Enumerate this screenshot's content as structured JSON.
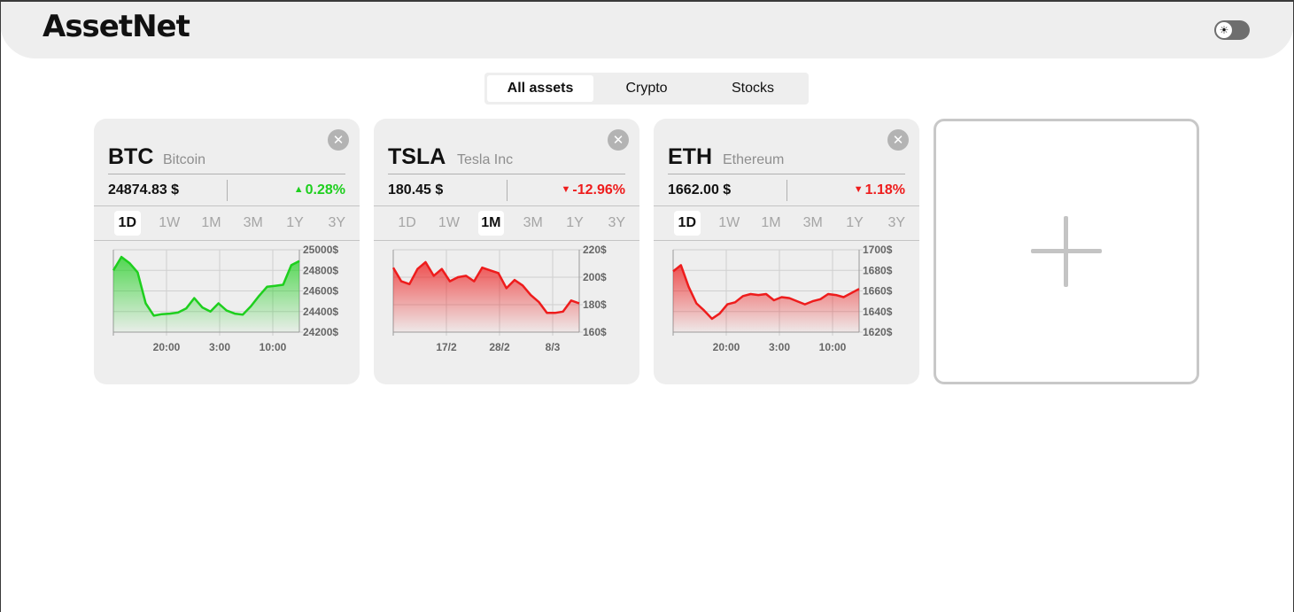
{
  "app": {
    "logo": "AssetNet"
  },
  "theme_toggle": {
    "icon": "sun-icon",
    "glyph": "☀"
  },
  "filter_tabs": [
    {
      "label": "All assets",
      "active": true
    },
    {
      "label": "Crypto",
      "active": false
    },
    {
      "label": "Stocks",
      "active": false
    }
  ],
  "close_glyph": "✕",
  "cards": [
    {
      "symbol": "BTC",
      "name": "Bitcoin",
      "price": "24874.83 $",
      "change": "0.28%",
      "direction": "up",
      "color": "#1ecf1e",
      "ranges": [
        "1D",
        "1W",
        "1M",
        "3M",
        "1Y",
        "3Y"
      ],
      "active_range": "1D",
      "chart_data": {
        "type": "area",
        "y_ticks": [
          "25000$",
          "24800$",
          "24600$",
          "24400$",
          "24200$"
        ],
        "y_range": [
          24200,
          25000
        ],
        "x_ticks": [
          "20:00",
          "3:00",
          "10:00"
        ],
        "values": [
          24800,
          24930,
          24870,
          24780,
          24480,
          24360,
          24375,
          24380,
          24390,
          24430,
          24530,
          24440,
          24400,
          24480,
          24410,
          24380,
          24370,
          24450,
          24550,
          24640,
          24650,
          24660,
          24850,
          24890
        ]
      }
    },
    {
      "symbol": "TSLA",
      "name": "Tesla Inc",
      "price": "180.45 $",
      "change": "-12.96%",
      "direction": "down",
      "color": "#ee1c1c",
      "ranges": [
        "1D",
        "1W",
        "1M",
        "3M",
        "1Y",
        "3Y"
      ],
      "active_range": "1M",
      "chart_data": {
        "type": "area",
        "y_ticks": [
          "220$",
          "200$",
          "180$",
          "160$"
        ],
        "y_range": [
          160,
          220
        ],
        "x_ticks": [
          "17/2",
          "28/2",
          "8/3"
        ],
        "values": [
          207,
          197,
          195,
          206,
          211,
          201,
          206,
          197,
          200,
          201,
          197,
          207,
          205,
          203,
          192,
          198,
          194,
          187,
          182,
          174,
          174,
          175,
          183,
          181
        ]
      }
    },
    {
      "symbol": "ETH",
      "name": "Ethereum",
      "price": "1662.00 $",
      "change": "1.18%",
      "direction": "down",
      "color": "#ee1c1c",
      "ranges": [
        "1D",
        "1W",
        "1M",
        "3M",
        "1Y",
        "3Y"
      ],
      "active_range": "1D",
      "chart_data": {
        "type": "area",
        "y_ticks": [
          "1700$",
          "1680$",
          "1660$",
          "1640$",
          "1620$"
        ],
        "y_range": [
          1620,
          1700
        ],
        "x_ticks": [
          "20:00",
          "3:00",
          "10:00"
        ],
        "values": [
          1679,
          1685,
          1664,
          1648,
          1641,
          1633,
          1638,
          1647,
          1649,
          1655,
          1657,
          1656,
          1657,
          1651,
          1654,
          1653,
          1650,
          1647,
          1650,
          1652,
          1657,
          1656,
          1654,
          1658,
          1662
        ]
      }
    }
  ],
  "add_card": {
    "icon": "plus-icon"
  }
}
